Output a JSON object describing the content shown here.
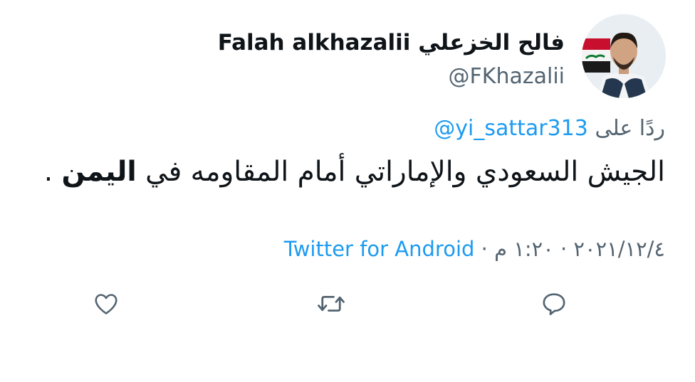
{
  "author": {
    "display_name": "فالح الخزعلي Falah alkhazalii",
    "handle": "@FKhazalii"
  },
  "reply_to": {
    "prefix": "ردًا على",
    "mention": "@yi_sattar313"
  },
  "tweet": {
    "text_main": "الجيش السعودي والإماراتي أمام المقاومه في ",
    "text_bold": "اليمن",
    "text_end": " ."
  },
  "meta": {
    "date": "٢٠٢١/١٢/٤",
    "separator_1": " · ",
    "time": "١:٢٠ م",
    "separator_2": " · ",
    "source": "Twitter for Android"
  },
  "colors": {
    "link": "#1d9bf0",
    "secondary_text": "#536471",
    "primary_text": "#0f1419"
  },
  "icons": {
    "like": "heart-icon",
    "retweet": "retweet-icon",
    "reply": "reply-icon"
  }
}
